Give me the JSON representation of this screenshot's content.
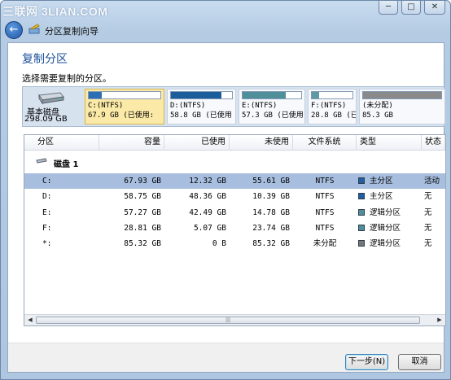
{
  "watermark": "三联网 3LIAN.COM",
  "window_controls": {
    "minimize": "─",
    "maximize": "□",
    "close": "✕"
  },
  "nav": {
    "back_icon": "back-arrow-icon",
    "title": "分区复制向导"
  },
  "heading": "复制分区",
  "instruction": "选择需要复制的分区。",
  "disk_strip": {
    "disk_label": "基本磁盘",
    "disk_size": "298.09 GB",
    "partitions": [
      {
        "name": "C:(NTFS)",
        "info": "67.9 GB (已使用:",
        "fill": 0.18,
        "color": "#2b6fb2",
        "selected": true
      },
      {
        "name": "D:(NTFS)",
        "info": "58.8 GB (已使用",
        "fill": 0.82,
        "color": "#1b5c9a",
        "selected": false
      },
      {
        "name": "E:(NTFS)",
        "info": "57.3 GB (已使用",
        "fill": 0.74,
        "color": "#4e8f9a",
        "selected": false
      },
      {
        "name": "F:(NTFS)",
        "info": "28.8 GB (已",
        "fill": 0.18,
        "color": "#5d9aa3",
        "selected": false
      },
      {
        "name": "(未分配)",
        "info": "85.3 GB",
        "fill": 1.0,
        "color": "#8a8a8a",
        "selected": false
      }
    ]
  },
  "table": {
    "columns": [
      "分区",
      "容量",
      "已使用",
      "未使用",
      "文件系统",
      "类型",
      "状态"
    ],
    "group_label": "磁盘 1",
    "rows": [
      {
        "part": "C:",
        "cap": "67.93 GB",
        "used": "12.32 GB",
        "free": "55.61 GB",
        "fs": "NTFS",
        "type": "主分区",
        "type_color": "#1f5fa4",
        "status": "活动",
        "selected": true
      },
      {
        "part": "D:",
        "cap": "58.75 GB",
        "used": "48.36 GB",
        "free": "10.39 GB",
        "fs": "NTFS",
        "type": "主分区",
        "type_color": "#1f5fa4",
        "status": "无",
        "selected": false
      },
      {
        "part": "E:",
        "cap": "57.27 GB",
        "used": "42.49 GB",
        "free": "14.78 GB",
        "fs": "NTFS",
        "type": "逻辑分区",
        "type_color": "#4e8f9a",
        "status": "无",
        "selected": false
      },
      {
        "part": "F:",
        "cap": "28.81 GB",
        "used": "5.07 GB",
        "free": "23.74 GB",
        "fs": "NTFS",
        "type": "逻辑分区",
        "type_color": "#4e8f9a",
        "status": "无",
        "selected": false
      },
      {
        "part": "*:",
        "cap": "85.32 GB",
        "used": "0 B",
        "free": "85.32 GB",
        "fs": "未分配",
        "type": "逻辑分区",
        "type_color": "#777777",
        "status": "无",
        "selected": false
      }
    ]
  },
  "buttons": {
    "next": "下一步(N)",
    "cancel": "取消"
  }
}
